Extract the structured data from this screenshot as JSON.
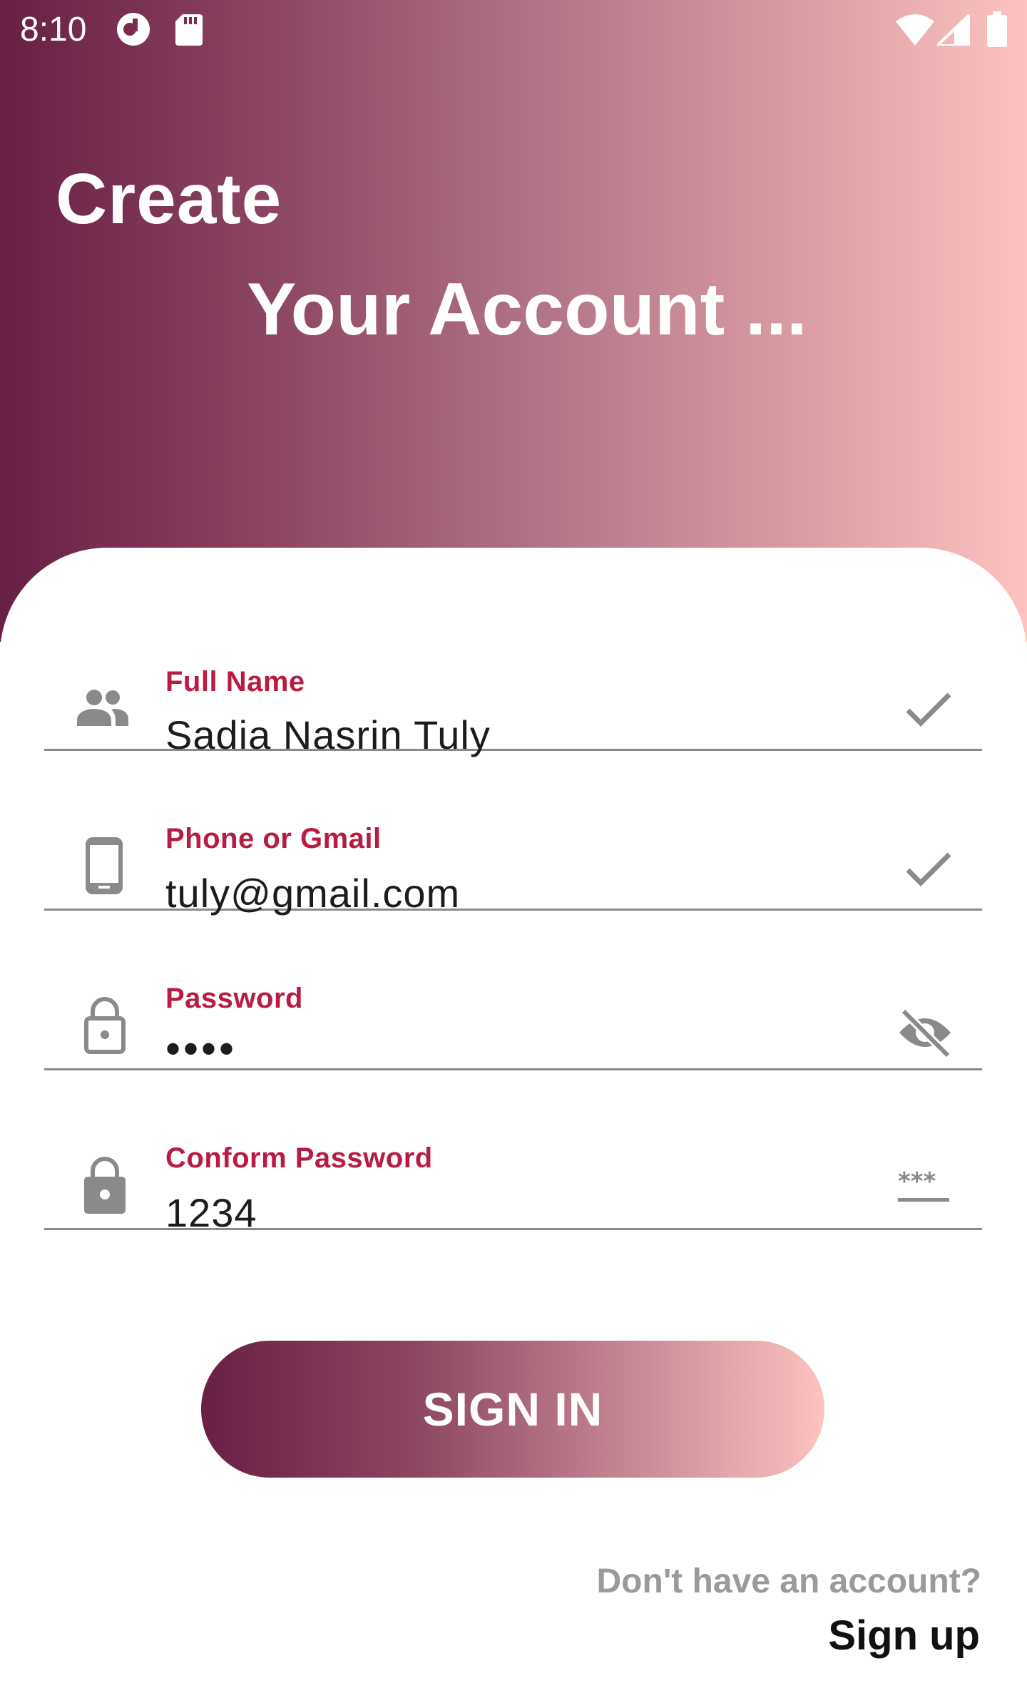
{
  "status_bar": {
    "time": "8:10",
    "icons": [
      "notification-circle-icon",
      "sd-card-icon",
      "wifi-icon",
      "signal-icon",
      "battery-icon"
    ]
  },
  "header": {
    "title_line1": "Create",
    "title_line2": "Your Account ..."
  },
  "form": {
    "fields": [
      {
        "label": "Full Name",
        "value": "Sadia Nasrin Tuly",
        "icon": "people-icon",
        "trailing": "check-icon"
      },
      {
        "label": "Phone or Gmail",
        "value": "tuly@gmail.com",
        "icon": "phone-icon",
        "trailing": "check-icon"
      },
      {
        "label": "Password",
        "value": "••••",
        "icon": "lock-open-icon",
        "trailing": "eye-off-icon"
      },
      {
        "label": "Conform Password",
        "value": "1234",
        "icon": "lock-icon",
        "trailing": "password-mask-icon"
      }
    ]
  },
  "actions": {
    "sign_in_label": "SIGN IN",
    "no_account_text": "Don't have an account?",
    "sign_up_label": "Sign up"
  },
  "colors": {
    "gradient_start": "#681f45",
    "gradient_end": "#fcc3c0",
    "label_accent": "#b81c40",
    "icon_grey": "#8a8a8a"
  }
}
